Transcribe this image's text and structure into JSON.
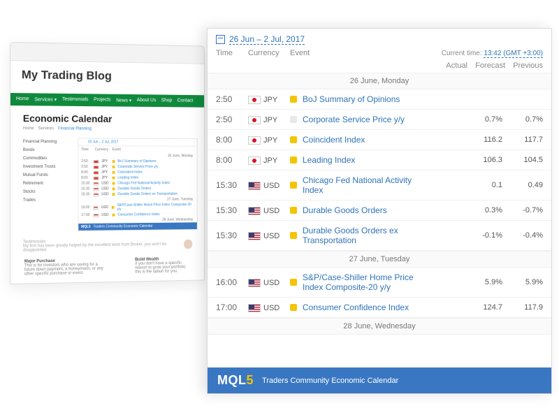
{
  "blog": {
    "title": "My Trading Blog",
    "nav": [
      "Home",
      "Services ▾",
      "Testimonials",
      "Projects",
      "News ▾",
      "About Us",
      "Shop",
      "Contact"
    ],
    "page_title": "Economic Calendar",
    "breadcrumb": {
      "home": "Home",
      "mid": "Services",
      "active": "Financial Planning"
    },
    "sidebar_items": [
      "Financial Planning",
      "Bonds",
      "Commodities",
      "Investment Trusts",
      "Mutual Funds",
      "Retirement",
      "Stocks",
      "Trades"
    ],
    "testimonials_label": "Testimonials",
    "testimonial_text": "My firm has been greatly helped by the excellent work from Broker, you won't be disappointed",
    "footer_left": {
      "h": "Major Purchase",
      "t": "This is for investors who are saving for a future down payment, a honeymoon, or any other specific purchase or event."
    },
    "footer_right": {
      "h": "Build Wealth",
      "t": "If you don't have a specific reason to grow your portfolio, this is the option for you."
    }
  },
  "mini_cal": {
    "range": "26 Jun – 2 Jul, 2017",
    "cols": {
      "time": "Time",
      "currency": "Currency",
      "event": "Event"
    },
    "day1": "26 June, Monday",
    "rows1": [
      {
        "t": "2:50",
        "c": "JPY",
        "ev": "BoJ Summary of Opinions"
      },
      {
        "t": "2:50",
        "c": "JPY",
        "ev": "Corporate Service Price y/y"
      },
      {
        "t": "8:00",
        "c": "JPY",
        "ev": "Coincident Index"
      },
      {
        "t": "8:00",
        "c": "JPY",
        "ev": "Leading Index"
      },
      {
        "t": "15:30",
        "c": "USD",
        "ev": "Chicago Fed National Activity Index"
      },
      {
        "t": "15:30",
        "c": "USD",
        "ev": "Durable Goods Orders"
      },
      {
        "t": "15:30",
        "c": "USD",
        "ev": "Durable Goods Orders ex Transportation"
      }
    ],
    "day2": "27 June, Tuesday",
    "rows2": [
      {
        "t": "16:00",
        "c": "USD",
        "ev": "S&P/Case-Shiller Home Price Index Composite-20 y/y"
      },
      {
        "t": "17:00",
        "c": "USD",
        "ev": "Consumer Confidence Index"
      }
    ],
    "day3": "28 June, Wednesday",
    "brand": "MQL5",
    "brand_tag": "Traders Community Economic Calendar"
  },
  "calendar": {
    "range": "26 Jun – 2 Jul, 2017",
    "cols": {
      "time": "Time",
      "currency": "Currency",
      "event": "Event",
      "actual": "Actual",
      "forecast": "Forecast",
      "previous": "Previous"
    },
    "current_label": "Current time:",
    "current_time": "13:42 (GMT +3:00)",
    "days": [
      {
        "header": "26 June, Monday",
        "events": [
          {
            "time": "2:50",
            "currency": "JPY",
            "flag": "jp",
            "impact": "med",
            "name": "BoJ Summary of Opinions",
            "actual": "",
            "forecast": "",
            "previous": ""
          },
          {
            "time": "2:50",
            "currency": "JPY",
            "flag": "jp",
            "impact": "low",
            "name": "Corporate Service Price y/y",
            "actual": "",
            "forecast": "0.7%",
            "previous": "0.7%"
          },
          {
            "time": "8:00",
            "currency": "JPY",
            "flag": "jp",
            "impact": "med",
            "name": "Coincident Index",
            "actual": "",
            "forecast": "116.2",
            "previous": "117.7"
          },
          {
            "time": "8:00",
            "currency": "JPY",
            "flag": "jp",
            "impact": "med",
            "name": "Leading Index",
            "actual": "",
            "forecast": "106.3",
            "previous": "104.5"
          },
          {
            "time": "15:30",
            "currency": "USD",
            "flag": "us",
            "impact": "med",
            "name": "Chicago Fed National Activity Index",
            "actual": "",
            "forecast": "0.1",
            "previous": "0.49"
          },
          {
            "time": "15:30",
            "currency": "USD",
            "flag": "us",
            "impact": "med",
            "name": "Durable Goods Orders",
            "actual": "",
            "forecast": "0.3%",
            "previous": "-0.7%"
          },
          {
            "time": "15:30",
            "currency": "USD",
            "flag": "us",
            "impact": "med",
            "name": "Durable Goods Orders ex Transportation",
            "actual": "",
            "forecast": "-0.1%",
            "previous": "-0.4%"
          }
        ]
      },
      {
        "header": "27 June, Tuesday",
        "events": [
          {
            "time": "16:00",
            "currency": "USD",
            "flag": "us",
            "impact": "med",
            "name": "S&P/Case-Shiller Home Price Index Composite-20 y/y",
            "actual": "",
            "forecast": "5.9%",
            "previous": "5.9%"
          },
          {
            "time": "17:00",
            "currency": "USD",
            "flag": "us",
            "impact": "med",
            "name": "Consumer Confidence Index",
            "actual": "",
            "forecast": "124.7",
            "previous": "117.9"
          }
        ]
      },
      {
        "header": "28 June, Wednesday",
        "events": []
      }
    ],
    "brand": "MQL",
    "brand5": "5",
    "brand_tag": "Traders Community Economic Calendar"
  }
}
